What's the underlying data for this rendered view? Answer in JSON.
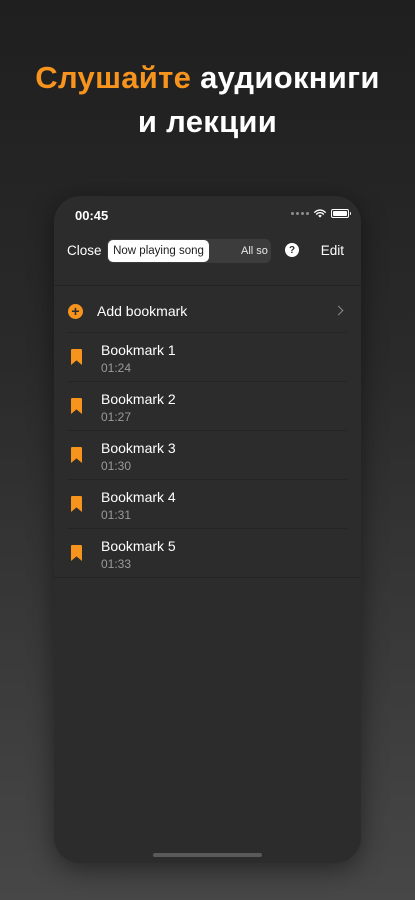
{
  "headline": {
    "accent": "Слушайте",
    "rest1": "аудиокниги",
    "line2": "и лекции"
  },
  "colors": {
    "accent": "#f7941d",
    "background": "#2c2c2c"
  },
  "status_bar": {
    "time": "00:45"
  },
  "navbar": {
    "close_label": "Close",
    "segments": [
      "Now playing song",
      "All so"
    ],
    "selected_segment": "Now playing song",
    "help_symbol": "?",
    "edit_label": "Edit"
  },
  "add_bookmark": {
    "label": "Add bookmark",
    "icon": "plus-circle-icon"
  },
  "bookmarks": [
    {
      "title": "Bookmark 1",
      "time": "01:24"
    },
    {
      "title": "Bookmark 2",
      "time": "01:27"
    },
    {
      "title": "Bookmark 3",
      "time": "01:30"
    },
    {
      "title": "Bookmark 4",
      "time": "01:31"
    },
    {
      "title": "Bookmark 5",
      "time": "01:33"
    }
  ]
}
